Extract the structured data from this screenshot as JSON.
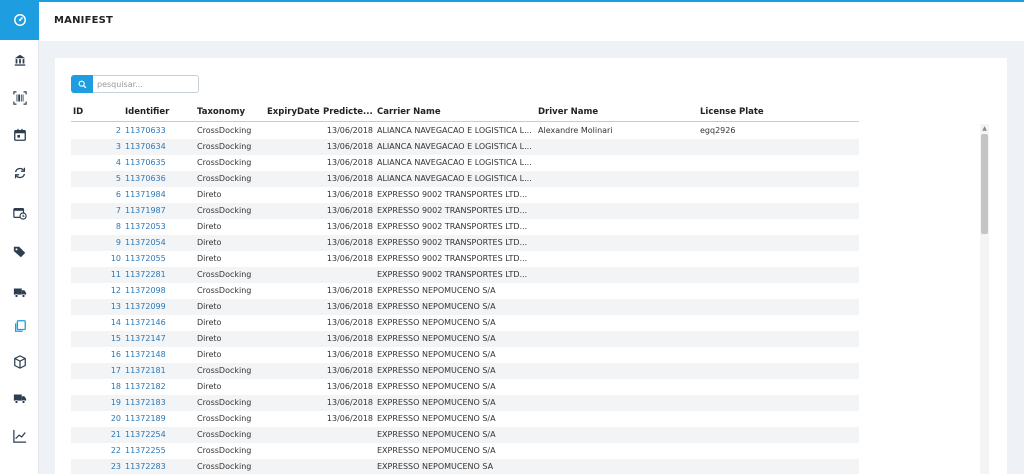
{
  "sidebar": {
    "items": [
      {
        "icon": "dashboard-gauge-icon",
        "active": true
      },
      {
        "icon": "bank-icon"
      },
      {
        "icon": "barcode-scan-icon"
      },
      {
        "icon": "calendar-icon"
      },
      {
        "icon": "refresh-sync-icon"
      },
      {
        "icon": "calendar-clock-icon"
      },
      {
        "icon": "tags-icon"
      },
      {
        "icon": "truck-icon"
      },
      {
        "icon": "manifest-copy-icon",
        "highlight": true
      },
      {
        "icon": "package-cube-icon"
      },
      {
        "icon": "delivery-truck-icon"
      },
      {
        "icon": "line-chart-icon"
      },
      {
        "icon": "more-dots-icon"
      }
    ],
    "accent": "#1e9ee0"
  },
  "header": {
    "title": "MANIFEST"
  },
  "search": {
    "placeholder": "pesquisar..."
  },
  "table": {
    "columns": {
      "id": "ID",
      "identifier": "Identifier",
      "taxonomy": "Taxonomy",
      "expiry": "ExpiryDate",
      "predicted": "Predicte...",
      "carrier": "Carrier Name",
      "driver": "Driver Name",
      "plate": "License Plate"
    },
    "rows": [
      {
        "id": "2",
        "identifier": "11370633",
        "taxonomy": "CrossDocking",
        "expiry": "",
        "predicted": "13/06/2018",
        "carrier": "ALIANCA NAVEGACAO E LOGISTICA L...",
        "driver": "Alexandre Molinari",
        "plate": "egq2926"
      },
      {
        "id": "3",
        "identifier": "11370634",
        "taxonomy": "CrossDocking",
        "expiry": "",
        "predicted": "13/06/2018",
        "carrier": "ALIANCA NAVEGACAO E LOGISTICA L...",
        "driver": "",
        "plate": ""
      },
      {
        "id": "4",
        "identifier": "11370635",
        "taxonomy": "CrossDocking",
        "expiry": "",
        "predicted": "13/06/2018",
        "carrier": "ALIANCA NAVEGACAO E LOGISTICA L...",
        "driver": "",
        "plate": ""
      },
      {
        "id": "5",
        "identifier": "11370636",
        "taxonomy": "CrossDocking",
        "expiry": "",
        "predicted": "13/06/2018",
        "carrier": "ALIANCA NAVEGACAO E LOGISTICA L...",
        "driver": "",
        "plate": ""
      },
      {
        "id": "6",
        "identifier": "11371984",
        "taxonomy": "Direto",
        "expiry": "",
        "predicted": "13/06/2018",
        "carrier": "EXPRESSO 9002 TRANSPORTES LTD...",
        "driver": "",
        "plate": ""
      },
      {
        "id": "7",
        "identifier": "11371987",
        "taxonomy": "CrossDocking",
        "expiry": "",
        "predicted": "13/06/2018",
        "carrier": "EXPRESSO 9002 TRANSPORTES LTD...",
        "driver": "",
        "plate": ""
      },
      {
        "id": "8",
        "identifier": "11372053",
        "taxonomy": "Direto",
        "expiry": "",
        "predicted": "13/06/2018",
        "carrier": "EXPRESSO 9002 TRANSPORTES LTD...",
        "driver": "",
        "plate": ""
      },
      {
        "id": "9",
        "identifier": "11372054",
        "taxonomy": "Direto",
        "expiry": "",
        "predicted": "13/06/2018",
        "carrier": "EXPRESSO 9002 TRANSPORTES LTD...",
        "driver": "",
        "plate": ""
      },
      {
        "id": "10",
        "identifier": "11372055",
        "taxonomy": "Direto",
        "expiry": "",
        "predicted": "13/06/2018",
        "carrier": "EXPRESSO 9002 TRANSPORTES LTD...",
        "driver": "",
        "plate": ""
      },
      {
        "id": "11",
        "identifier": "11372281",
        "taxonomy": "CrossDocking",
        "expiry": "",
        "predicted": "",
        "carrier": "EXPRESSO 9002 TRANSPORTES LTD...",
        "driver": "",
        "plate": ""
      },
      {
        "id": "12",
        "identifier": "11372098",
        "taxonomy": "CrossDocking",
        "expiry": "",
        "predicted": "13/06/2018",
        "carrier": "EXPRESSO NEPOMUCENO S/A",
        "driver": "",
        "plate": ""
      },
      {
        "id": "13",
        "identifier": "11372099",
        "taxonomy": "Direto",
        "expiry": "",
        "predicted": "13/06/2018",
        "carrier": "EXPRESSO NEPOMUCENO S/A",
        "driver": "",
        "plate": ""
      },
      {
        "id": "14",
        "identifier": "11372146",
        "taxonomy": "Direto",
        "expiry": "",
        "predicted": "13/06/2018",
        "carrier": "EXPRESSO NEPOMUCENO S/A",
        "driver": "",
        "plate": ""
      },
      {
        "id": "15",
        "identifier": "11372147",
        "taxonomy": "Direto",
        "expiry": "",
        "predicted": "13/06/2018",
        "carrier": "EXPRESSO NEPOMUCENO S/A",
        "driver": "",
        "plate": ""
      },
      {
        "id": "16",
        "identifier": "11372148",
        "taxonomy": "Direto",
        "expiry": "",
        "predicted": "13/06/2018",
        "carrier": "EXPRESSO NEPOMUCENO S/A",
        "driver": "",
        "plate": ""
      },
      {
        "id": "17",
        "identifier": "11372181",
        "taxonomy": "CrossDocking",
        "expiry": "",
        "predicted": "13/06/2018",
        "carrier": "EXPRESSO NEPOMUCENO S/A",
        "driver": "",
        "plate": ""
      },
      {
        "id": "18",
        "identifier": "11372182",
        "taxonomy": "Direto",
        "expiry": "",
        "predicted": "13/06/2018",
        "carrier": "EXPRESSO NEPOMUCENO S/A",
        "driver": "",
        "plate": ""
      },
      {
        "id": "19",
        "identifier": "11372183",
        "taxonomy": "CrossDocking",
        "expiry": "",
        "predicted": "13/06/2018",
        "carrier": "EXPRESSO NEPOMUCENO S/A",
        "driver": "",
        "plate": ""
      },
      {
        "id": "20",
        "identifier": "11372189",
        "taxonomy": "CrossDocking",
        "expiry": "",
        "predicted": "13/06/2018",
        "carrier": "EXPRESSO NEPOMUCENO S/A",
        "driver": "",
        "plate": ""
      },
      {
        "id": "21",
        "identifier": "11372254",
        "taxonomy": "CrossDocking",
        "expiry": "",
        "predicted": "",
        "carrier": "EXPRESSO NEPOMUCENO S/A",
        "driver": "",
        "plate": ""
      },
      {
        "id": "22",
        "identifier": "11372255",
        "taxonomy": "CrossDocking",
        "expiry": "",
        "predicted": "",
        "carrier": "EXPRESSO NEPOMUCENO S/A",
        "driver": "",
        "plate": ""
      },
      {
        "id": "23",
        "identifier": "11372283",
        "taxonomy": "CrossDocking",
        "expiry": "",
        "predicted": "",
        "carrier": "EXPRESSO NEPOMUCENO SA",
        "driver": "",
        "plate": ""
      }
    ]
  }
}
